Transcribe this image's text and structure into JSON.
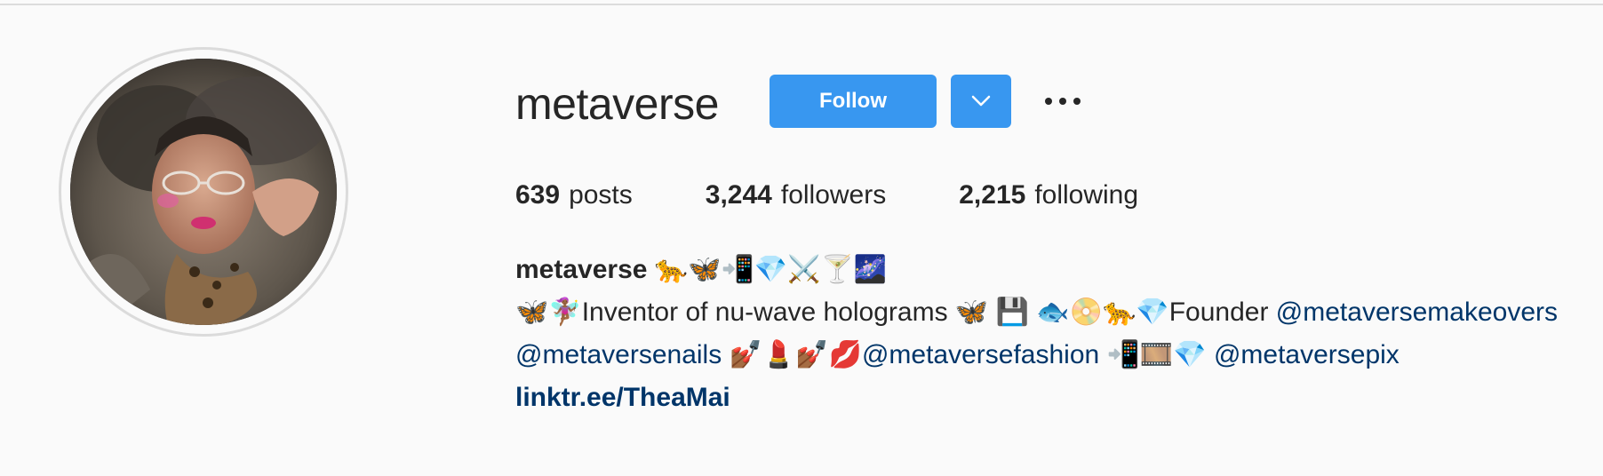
{
  "profile": {
    "username": "metaverse",
    "follow_label": "Follow",
    "more_label": "•••",
    "stats": {
      "posts_count": "639",
      "posts_label": "posts",
      "followers_count": "3,244",
      "followers_label": "followers",
      "following_count": "2,215",
      "following_label": "following"
    },
    "bio": {
      "name": "metaverse",
      "name_emojis": "🐆🦋📲💎⚔️🍸🌌",
      "line1_prefix": "🦋🧚🏾‍♀️Inventor of nu-wave holograms 🦋 💾 🐟📀🐆💎Founder ",
      "mention1": "@metaversemakeovers",
      "mention2": "@metaversenails",
      "line2_middle": " 💅🏾💄💅🏾💋",
      "mention3": "@metaversefashion",
      "line2_after": " 📲🎞️💎 ",
      "mention4": "@metaversepix",
      "link": "linktr.ee/TheaMai"
    }
  },
  "colors": {
    "accent": "#3897f0",
    "mention": "#003569",
    "text": "#262626",
    "background": "#fafafa"
  },
  "icons": {
    "dropdown": "chevron-down-icon",
    "more": "more-horizontal-icon"
  }
}
